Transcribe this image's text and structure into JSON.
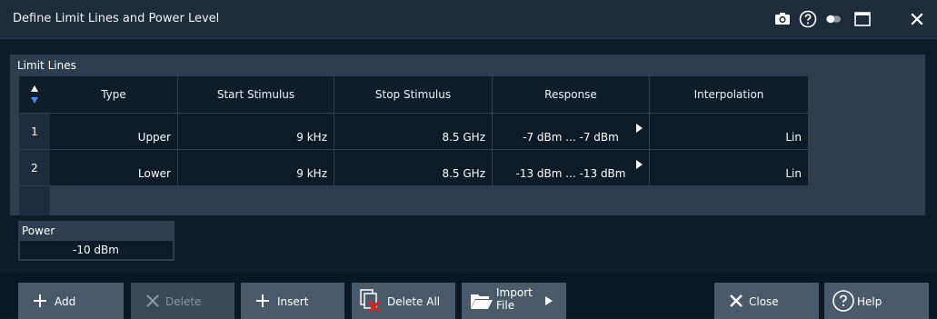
{
  "dialog": {
    "title": "Define Limit Lines and Power Level"
  },
  "title_icons": [
    "camera-icon",
    "help-circle-icon",
    "toggle-icon",
    "maximize-icon",
    "close-icon"
  ],
  "limit_lines": {
    "title": "Limit Lines",
    "columns": [
      "Type",
      "Start Stimulus",
      "Stop Stimulus",
      "Response",
      "Interpolation"
    ],
    "rows": [
      {
        "num": "1",
        "type": "Upper",
        "start": "9 kHz",
        "stop": "8.5 GHz",
        "response": "-7 dBm ... -7 dBm",
        "interpolation": "Lin"
      },
      {
        "num": "2",
        "type": "Lower",
        "start": "9 kHz",
        "stop": "8.5 GHz",
        "response": "-13 dBm ... -13 dBm",
        "interpolation": "Lin"
      }
    ]
  },
  "power": {
    "label": "Power",
    "value": "-10 dBm"
  },
  "buttons": {
    "add": "Add",
    "delete": "Delete",
    "insert": "Insert",
    "delete_all": "Delete All",
    "import_line1": "Import",
    "import_line2": "File",
    "close": "Close",
    "help": "Help"
  },
  "colors": {
    "accent_blue": "#3a8ee6",
    "delete_red": "#e02020"
  }
}
